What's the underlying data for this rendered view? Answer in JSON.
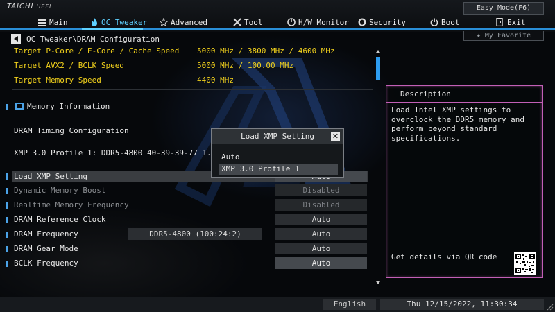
{
  "brand": {
    "name": "TAICHI",
    "suffix": "UEFI"
  },
  "easy_mode": "Easy Mode(F6)",
  "tabs": [
    {
      "label": "Main",
      "icon": "list-icon"
    },
    {
      "label": "OC Tweaker",
      "icon": "flame-icon",
      "active": true
    },
    {
      "label": "Advanced",
      "icon": "star-icon"
    },
    {
      "label": "Tool",
      "icon": "tools-icon"
    },
    {
      "label": "H/W Monitor",
      "icon": "power-ring-icon"
    },
    {
      "label": "Security",
      "icon": "shield-icon"
    },
    {
      "label": "Boot",
      "icon": "power-icon"
    },
    {
      "label": "Exit",
      "icon": "exit-door-icon"
    }
  ],
  "breadcrumb": "OC Tweaker\\DRAM Configuration",
  "favorite": "My Favorite",
  "targets": [
    {
      "label": "Target P-Core / E-Core / Cache Speed",
      "value": "5000 MHz / 3800 MHz / 4600 MHz"
    },
    {
      "label": "Target AVX2 / BCLK Speed",
      "value": "5000 MHz / 100.00 MHz"
    },
    {
      "label": "Target Memory Speed",
      "value": "4400 MHz"
    }
  ],
  "memory_info": "Memory Information",
  "dram_timing": "DRAM Timing Configuration",
  "xmp_profile": "XMP 3.0 Profile 1: DDR5-4800 40-39-39-77 1.10V 2DPC",
  "settings": [
    {
      "label": "Load XMP Setting",
      "value": "Auto"
    },
    {
      "label": "Dynamic Memory Boost",
      "value": "Disabled"
    },
    {
      "label": "Realtime Memory Frequency",
      "value": "Disabled"
    },
    {
      "label": "DRAM Reference Clock",
      "value": "Auto"
    },
    {
      "label": "DRAM Frequency",
      "value": "Auto",
      "info": "DDR5-4800 (100:24:2)"
    },
    {
      "label": "DRAM Gear Mode",
      "value": "Auto"
    },
    {
      "label": "BCLK Frequency",
      "value": "Auto"
    }
  ],
  "description": {
    "title": "Description",
    "text": "Load Intel XMP settings to overclock the DDR5 memory and perform beyond standard specifications.",
    "qr_text": "Get details via QR code"
  },
  "modal": {
    "title": "Load XMP Setting",
    "options": [
      "Auto",
      "XMP 3.0 Profile 1"
    ],
    "selected_index": 1
  },
  "footer": {
    "language": "English",
    "datetime": "Thu 12/15/2022, 11:30:34"
  },
  "colors": {
    "accent_blue": "#2a8fd8",
    "active_tab": "#5fd1ff",
    "target_yellow": "#f3d21c",
    "panel_border": "#c25fb6"
  }
}
